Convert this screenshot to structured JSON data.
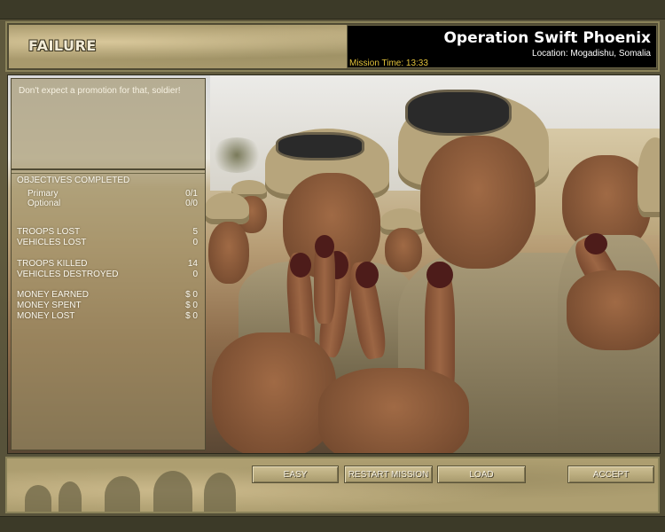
{
  "header": {
    "result_label": "FAILURE",
    "mission_title": "Operation Swift Phoenix",
    "location": "Location: Mogadishu, Somalia",
    "mission_time": "Mission Time: 13:33"
  },
  "panel": {
    "quote": "Don't expect a promotion for that, soldier!",
    "objectives_heading": "OBJECTIVES COMPLETED",
    "objectives": [
      {
        "label": "Primary",
        "value": "0/1"
      },
      {
        "label": "Optional",
        "value": "0/0"
      }
    ],
    "losses": [
      {
        "label": "TROOPS LOST",
        "value": "5"
      },
      {
        "label": "VEHICLES LOST",
        "value": "0"
      }
    ],
    "kills": [
      {
        "label": "TROOPS KILLED",
        "value": "14"
      },
      {
        "label": "VEHICLES DESTROYED",
        "value": "0"
      }
    ],
    "money": [
      {
        "label": "MONEY EARNED",
        "value": "$ 0"
      },
      {
        "label": "MONEY SPENT",
        "value": "$ 0"
      },
      {
        "label": "MONEY LOST",
        "value": "$ 0"
      }
    ]
  },
  "buttons": {
    "easy": "EASY",
    "restart": "RESTART MISSION",
    "load": "LOAD",
    "accept": "ACCEPT"
  },
  "colors": {
    "mission_time": "#e2c23a",
    "frame": "#57523a",
    "header_sand": "#a99a6d"
  }
}
